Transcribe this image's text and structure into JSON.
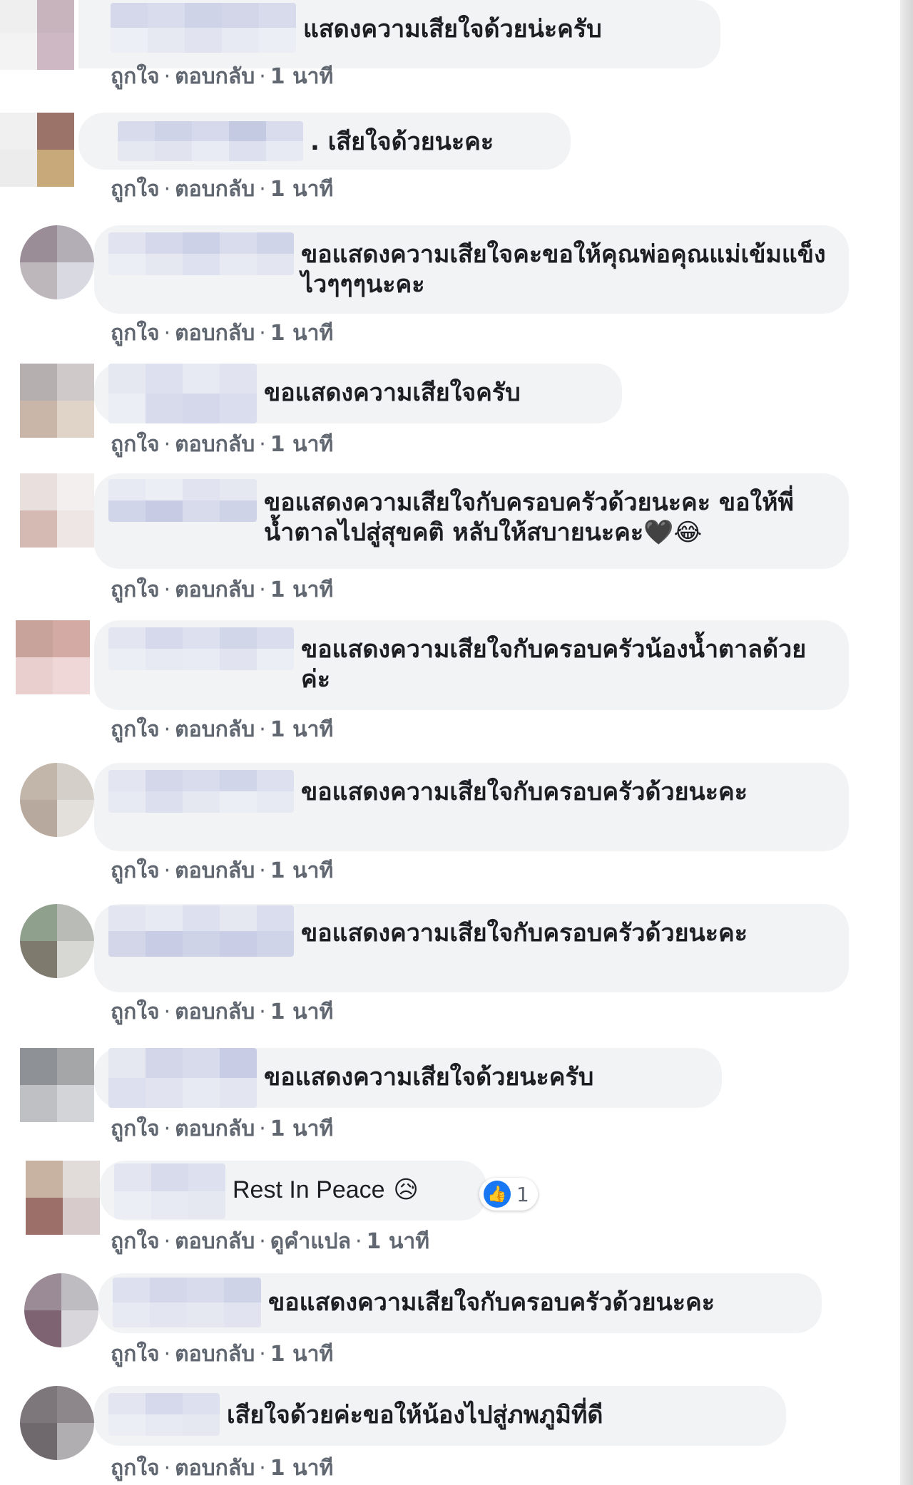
{
  "comments": [
    {
      "text": "แสดงความเสียใจด้วยน่ะครับ",
      "actions": {
        "like": "ถูกใจ",
        "reply": "ตอบกลับ",
        "time": "1 นาที"
      }
    },
    {
      "text": ". เสียใจด้วยนะคะ",
      "actions": {
        "like": "ถูกใจ",
        "reply": "ตอบกลับ",
        "time": "1 นาที"
      }
    },
    {
      "text": "ขอแสดงความเสียใจคะขอให้คุณพ่อคุณแม่เข้มแข็งไวๆๆๆนะคะ",
      "actions": {
        "like": "ถูกใจ",
        "reply": "ตอบกลับ",
        "time": "1 นาที"
      }
    },
    {
      "text": "ขอแสดงความเสียใจครับ",
      "actions": {
        "like": "ถูกใจ",
        "reply": "ตอบกลับ",
        "time": "1 นาที"
      }
    },
    {
      "text": "ขอแสดงความเสียใจกับครอบครัวด้วยนะคะ ขอให้พี่น้ำตาลไปสู่สุขคติ หลับให้สบายนะคะ",
      "emoji": "🖤😂",
      "actions": {
        "like": "ถูกใจ",
        "reply": "ตอบกลับ",
        "time": "1 นาที"
      }
    },
    {
      "text": "ขอแสดงความเสียใจกับครอบครัวน้องน้ำตาลด้วยค่ะ",
      "actions": {
        "like": "ถูกใจ",
        "reply": "ตอบกลับ",
        "time": "1 นาที"
      }
    },
    {
      "text": "ขอแสดงความเสียใจกับครอบครัวด้วยนะคะ",
      "actions": {
        "like": "ถูกใจ",
        "reply": "ตอบกลับ",
        "time": "1 นาที"
      }
    },
    {
      "text": "ขอแสดงความเสียใจกับครอบครัวด้วยนะคะ",
      "actions": {
        "like": "ถูกใจ",
        "reply": "ตอบกลับ",
        "time": "1 นาที"
      }
    },
    {
      "text": "ขอแสดงความเสียใจด้วยนะครับ",
      "actions": {
        "like": "ถูกใจ",
        "reply": "ตอบกลับ",
        "time": "1 นาที"
      }
    },
    {
      "text": "Rest In Peace",
      "emoji": "😥",
      "reaction_count": "1",
      "actions": {
        "like": "ถูกใจ",
        "reply": "ตอบกลับ",
        "translate": "ดูคำแปล",
        "time": "1 นาที"
      }
    },
    {
      "text": "ขอแสดงความเสียใจกับครอบครัวด้วยนะคะ",
      "actions": {
        "like": "ถูกใจ",
        "reply": "ตอบกลับ",
        "time": "1 นาที"
      }
    },
    {
      "text": "เสียใจด้วยค่ะขอให้น้องไปสู่ภพภูมิที่ดี",
      "actions": {
        "like": "ถูกใจ",
        "reply": "ตอบกลับ",
        "time": "1 นาที"
      }
    }
  ],
  "separator": "·",
  "colors": {
    "bubble": "#f2f3f5",
    "action_text": "#606770",
    "like_blue": "#1877f2",
    "blur_tint": "#c9cde6"
  }
}
